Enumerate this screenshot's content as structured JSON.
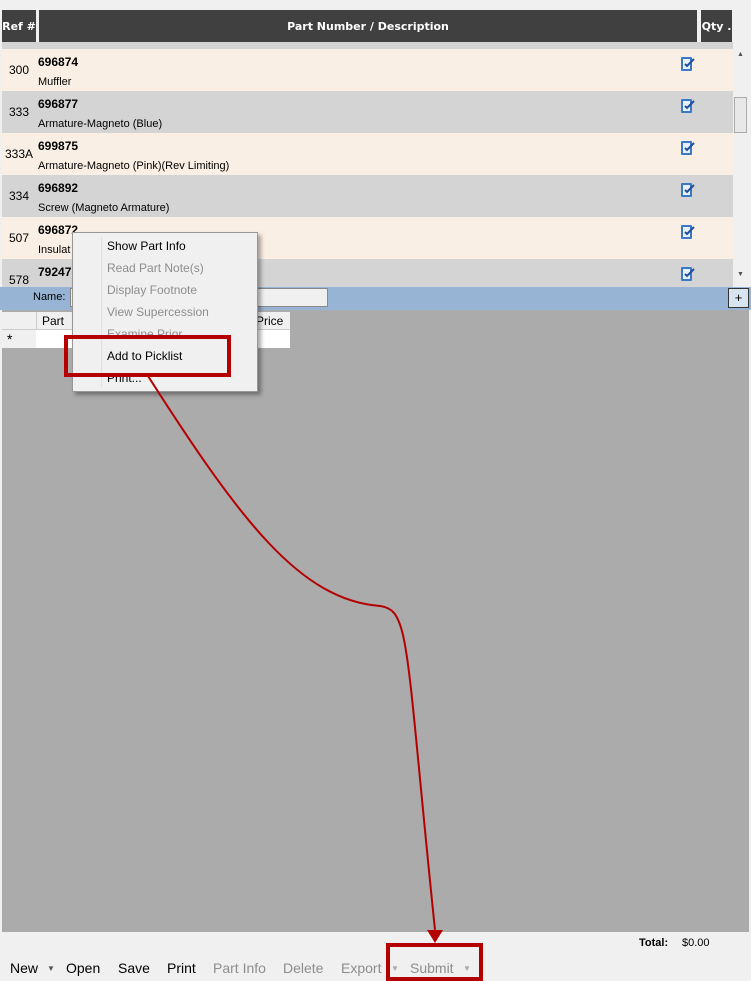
{
  "table": {
    "headers": {
      "ref": "Ref #",
      "part": "Part Number / Description",
      "qty": "Qty ."
    },
    "rows": [
      {
        "ref": "300",
        "part": "696874",
        "desc": "Muffler"
      },
      {
        "ref": "333",
        "part": "696877",
        "desc": "Armature-Magneto (Blue)"
      },
      {
        "ref": "333A",
        "part": "699875",
        "desc": "Armature-Magneto (Pink)(Rev Limiting)"
      },
      {
        "ref": "334",
        "part": "696892",
        "desc": "Screw (Magneto Armature)"
      },
      {
        "ref": "507",
        "part": "696872",
        "desc": "Insulat"
      },
      {
        "ref": "578",
        "part": "79247",
        "desc": ""
      }
    ]
  },
  "picklist": {
    "name_label": "Name:",
    "name_value": "",
    "add_button": "+",
    "columns": [
      "Part",
      "Price"
    ],
    "new_row_marker": "*"
  },
  "context_menu": [
    {
      "label": "Show Part Info",
      "enabled": true
    },
    {
      "label": "Read Part Note(s)",
      "enabled": false
    },
    {
      "label": "Display Footnote",
      "enabled": false
    },
    {
      "label": "View Supercession",
      "enabled": false
    },
    {
      "label": "Examine Prior",
      "enabled": false
    },
    {
      "label": "Add to Picklist",
      "enabled": true
    },
    {
      "label": "Print...",
      "enabled": true
    }
  ],
  "total": {
    "label": "Total:",
    "value": "$0.00"
  },
  "toolbar": {
    "new": "New",
    "open": "Open",
    "save": "Save",
    "print": "Print",
    "part_info": "Part Info",
    "delete": "Delete",
    "export": "Export",
    "submit": "Submit"
  },
  "colors": {
    "header": "#404040",
    "row_odd": "#faefe4",
    "row_even": "#d4d4d4",
    "highlight": "#b40000",
    "name_bar": "#98b4d4"
  }
}
